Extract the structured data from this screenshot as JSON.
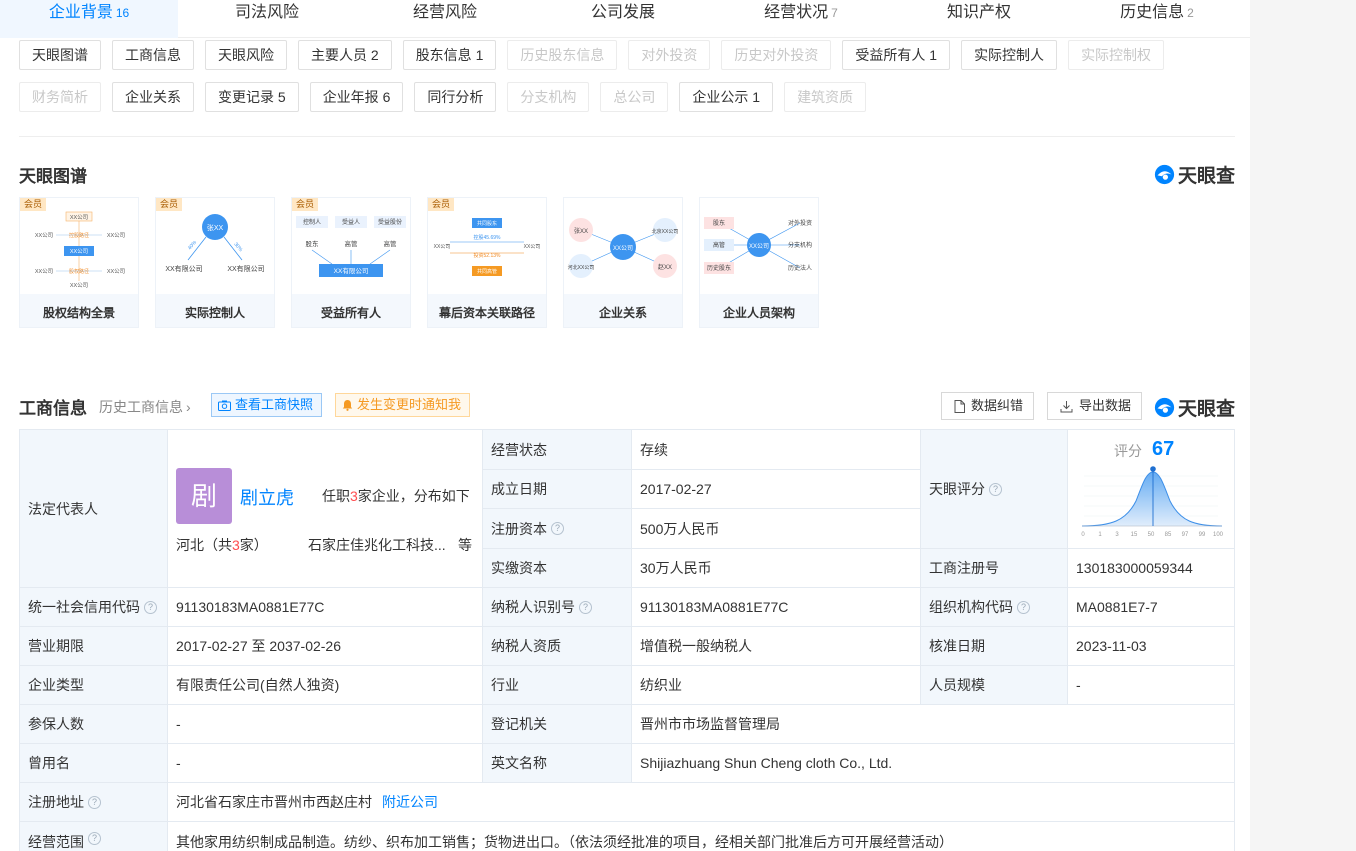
{
  "tabs": [
    {
      "label": "企业背景",
      "count": "16"
    },
    {
      "label": "司法风险",
      "count": ""
    },
    {
      "label": "经营风险",
      "count": ""
    },
    {
      "label": "公司发展",
      "count": ""
    },
    {
      "label": "经营状况",
      "count": "7"
    },
    {
      "label": "知识产权",
      "count": ""
    },
    {
      "label": "历史信息",
      "count": "2"
    }
  ],
  "tags_row1": [
    "天眼图谱",
    "工商信息",
    "天眼风险",
    "主要人员 2",
    "股东信息 1",
    "历史股东信息",
    "对外投资",
    "历史对外投资",
    "受益所有人 1",
    "实际控制人",
    "实际控制权"
  ],
  "tags_row2": [
    "财务简析",
    "企业关系",
    "变更记录 5",
    "企业年报 6",
    "同行分析",
    "分支机构",
    "总公司",
    "企业公示 1",
    "建筑资质"
  ],
  "graph": {
    "title": "天眼图谱",
    "brand": "天眼查",
    "vip": "会员",
    "cards": [
      "股权结构全景",
      "实际控制人",
      "受益所有人",
      "幕后资本关联路径",
      "企业关系",
      "企业人员架构"
    ],
    "thumb_text": {
      "c1": [
        "XX公司",
        "XX公司",
        "XX公司",
        "XX公司",
        "XX公司",
        "XX公司",
        "XX公司",
        "控股路径",
        "股权路径"
      ],
      "c2": [
        "张XX",
        "XX有限公司",
        "XX有限公司",
        "40%",
        "30%"
      ],
      "c3": [
        "控制人",
        "受益人",
        "受益股份",
        "股东",
        "高管",
        "高管",
        "XX有限公司"
      ],
      "c4": [
        "共同股东",
        "控股45.69%",
        "XX公司",
        "XX公司",
        "投资52.13%",
        "共同高管"
      ],
      "c5": [
        "张XX",
        "XX公司",
        "北京XX公司",
        "河北XX公司",
        "赵XX"
      ],
      "c6": [
        "股东",
        "对外投资",
        "高管",
        "XX公司",
        "分支机构",
        "历史股东",
        "历史法人"
      ]
    }
  },
  "biz": {
    "title": "工商信息",
    "history_link": "历史工商信息",
    "snapshot_btn": "查看工商快照",
    "notify_btn": "发生变更时通知我",
    "correct_btn": "数据纠错",
    "export_btn": "导出数据",
    "brand": "天眼查"
  },
  "legal": {
    "label": "法定代表人",
    "avatar": "剧",
    "name": "剧立虎",
    "tenure_pre": "任职",
    "tenure_num": "3",
    "tenure_post": "家企业，分布如下",
    "region_pre": "河北（共",
    "region_num": "3",
    "region_post": "家）",
    "company": "石家庄佳兆化工科技...",
    "etc": "等"
  },
  "table": {
    "status_label": "经营状态",
    "status": "存续",
    "found_label": "成立日期",
    "found": "2017-02-27",
    "reg_cap_label": "注册资本",
    "reg_cap": "500万人民币",
    "paid_cap_label": "实缴资本",
    "paid_cap": "30万人民币",
    "score_label": "天眼评分",
    "score_text": "评分",
    "score": "67",
    "score_ticks": [
      "0",
      "1",
      "3",
      "15",
      "50",
      "85",
      "97",
      "99",
      "100"
    ],
    "regno_label": "工商注册号",
    "regno": "130183000059344",
    "uscc_label": "统一社会信用代码",
    "uscc": "91130183MA0881E77C",
    "taxid_label": "纳税人识别号",
    "taxid": "91130183MA0881E77C",
    "org_label": "组织机构代码",
    "org": "MA0881E7-7",
    "term_label": "营业期限",
    "term": "2017-02-27 至 2037-02-26",
    "taxq_label": "纳税人资质",
    "taxq": "增值税一般纳税人",
    "approve_label": "核准日期",
    "approve": "2023-11-03",
    "type_label": "企业类型",
    "type": "有限责任公司(自然人独资)",
    "industry_label": "行业",
    "industry": "纺织业",
    "staff_label": "人员规模",
    "staff": "-",
    "insured_label": "参保人数",
    "insured": "-",
    "authority_label": "登记机关",
    "authority": "晋州市市场监督管理局",
    "former_label": "曾用名",
    "former": "-",
    "en_label": "英文名称",
    "en": "Shijiazhuang Shun Cheng cloth Co., Ltd.",
    "addr_label": "注册地址",
    "addr": "河北省石家庄市晋州市西赵庄村",
    "nearby": "附近公司",
    "scope_label": "经营范围",
    "scope": "其他家用纺织制成品制造。纺纱、织布加工销售；货物进出口。（依法须经批准的项目，经相关部门批准后方可开展经营活动）",
    "qmark": "?"
  }
}
